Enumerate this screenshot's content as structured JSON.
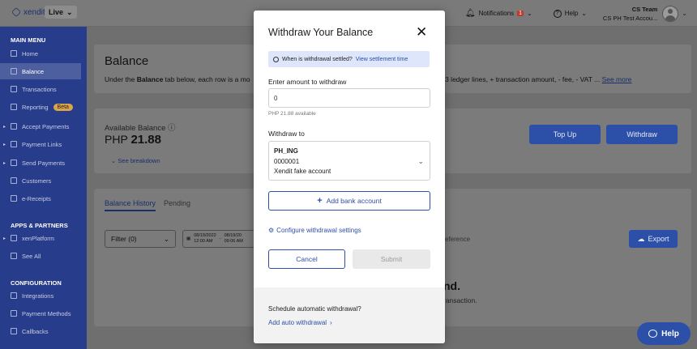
{
  "topbar": {
    "logo_text": "xendit",
    "environment": "Live",
    "notifications_label": "Notifications",
    "notifications_count": "1",
    "help_label": "Help",
    "user_name": "CS Team",
    "user_account": "CS PH Test Accou..."
  },
  "sidebar": {
    "main_menu_heading": "MAIN MENU",
    "main_items": [
      {
        "label": "Home",
        "icon": "home-icon"
      },
      {
        "label": "Balance",
        "icon": "balance-icon",
        "active": true
      },
      {
        "label": "Transactions",
        "icon": "transactions-icon"
      },
      {
        "label": "Reporting",
        "icon": "reporting-icon",
        "badge": "Beta"
      },
      {
        "label": "Accept Payments",
        "icon": "accept-payments-icon"
      },
      {
        "label": "Payment Links",
        "icon": "payment-links-icon"
      },
      {
        "label": "Send Payments",
        "icon": "send-payments-icon"
      },
      {
        "label": "Customers",
        "icon": "customers-icon"
      },
      {
        "label": "e-Receipts",
        "icon": "receipts-icon"
      }
    ],
    "apps_heading": "APPS & PARTNERS",
    "apps_items": [
      {
        "label": "xenPlatform",
        "icon": "platform-icon"
      },
      {
        "label": "See All",
        "icon": "grid-icon"
      }
    ],
    "config_heading": "CONFIGURATION",
    "config_items": [
      {
        "label": "Integrations",
        "icon": "integrations-icon"
      },
      {
        "label": "Payment Methods",
        "icon": "payment-methods-icon"
      },
      {
        "label": "Callbacks",
        "icon": "callbacks-icon"
      }
    ]
  },
  "balance_page": {
    "title": "Balance",
    "description_start": "Under the ",
    "description_bold": "Balance",
    "description_mid": " tab below, each row is a mo",
    "description_end": "h 3 ledger lines, + transaction amount, - fee, - VAT ... ",
    "see_more": "See more",
    "available_label": "Available Balance",
    "currency": "PHP",
    "available_amount": "21.88",
    "see_breakdown": "See breakdown",
    "top_up_label": "Top Up",
    "withdraw_label": "Withdraw",
    "tab_history": "Balance History",
    "tab_pending": "Pending",
    "filter_label": "Filter (0)",
    "date_from": "08/19/2022",
    "time_from": "12:00 AM",
    "date_to": "08/19/20",
    "time_to": "09:06 AM",
    "reference_placeholder": "y Reference",
    "export_label": "Export",
    "empty_title": "nd.",
    "empty_subtitle": "ransaction."
  },
  "modal": {
    "title": "Withdraw Your Balance",
    "info_text": "When is withdrawal settled?",
    "info_link": "View settlement time",
    "amount_label": "Enter amount to withdraw",
    "amount_value": "0",
    "amount_hint": "PHP 21.88 available",
    "withdraw_to_label": "Withdraw to",
    "bank_code": "PH_ING",
    "account_number": "0000001",
    "account_name": "Xendit fake account",
    "add_bank_label": "Add bank account",
    "configure_label": "Configure withdrawal settings",
    "cancel_label": "Cancel",
    "submit_label": "Submit",
    "schedule_question": "Schedule automatic withdrawal?",
    "auto_withdrawal_link": "Add auto withdrawal"
  },
  "fab": {
    "label": "Help"
  },
  "colors": {
    "brand_blue": "#2c4fa8",
    "sidebar_bg": "#283c8c",
    "info_bg": "#dde6fa",
    "badge_red": "#c0392b"
  }
}
